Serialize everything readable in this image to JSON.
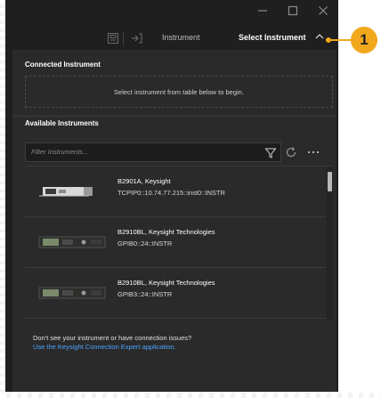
{
  "window": {
    "controls": [
      "minimize",
      "maximize",
      "close"
    ]
  },
  "toolbar": {
    "instrument_label": "Instrument",
    "select_label": "Select Instrument"
  },
  "connected": {
    "heading": "Connected Instrument",
    "message": "Select instrument from table below to begin."
  },
  "available": {
    "heading": "Available Instruments",
    "filter_placeholder": "Filter Instruments..."
  },
  "instruments": [
    {
      "name": "B2901A, Keysight",
      "address": "TCPIP0::10.74.77.215::inst0::INSTR"
    },
    {
      "name": "B2910BL, Keysight Technologies",
      "address": "GPIB0::24::INSTR"
    },
    {
      "name": "B2910BL, Keysight Technologies",
      "address": "GPIB3::24::INSTR"
    }
  ],
  "help": {
    "question": "Don't see your instrument or have connection issues?",
    "link": "Use the Keysight Connection Expert application."
  },
  "callout": {
    "number": "1"
  },
  "colors": {
    "accent": "#f2a81d",
    "link": "#4da3ff",
    "background": "#1f1f1f",
    "panel": "#2a2a2a"
  }
}
